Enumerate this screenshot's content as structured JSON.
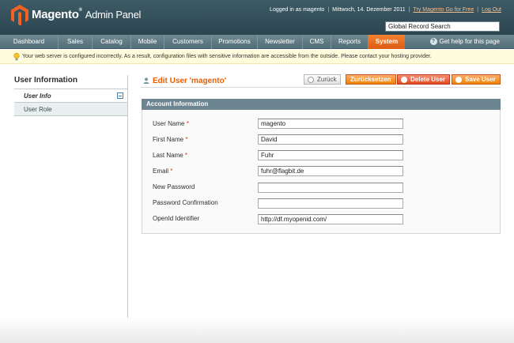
{
  "header": {
    "brand": "Magento",
    "brand_tm": "®",
    "brand_sub": "Admin Panel",
    "logged_in": "Logged in as magento",
    "date": "Mittwoch, 14. Dezember 2011",
    "try_go_link": "Try Magento Go for Free",
    "logout_link": "Log Out",
    "search_value": "Global Record Search"
  },
  "nav": {
    "items": [
      "Dashboard",
      "Sales",
      "Catalog",
      "Mobile",
      "Customers",
      "Promotions",
      "Newsletter",
      "CMS",
      "Reports",
      "System"
    ],
    "active": "System",
    "help": "Get help for this page"
  },
  "message": "Your web server is configured incorrectly. As a result, configuration files with sensitive information are accessible from the outside. Please contact your hosting provider.",
  "sidebar": {
    "title": "User Information",
    "tabs": [
      "User Info",
      "User Role"
    ]
  },
  "content": {
    "title": "Edit User 'magento'",
    "buttons": {
      "back": "Zurück",
      "reset": "Zurücksetzen",
      "delete": "Delete User",
      "save": "Save User"
    },
    "fieldset_title": "Account Information",
    "fields": [
      {
        "label": "User Name",
        "required": "*",
        "value": "magento"
      },
      {
        "label": "First Name",
        "required": "*",
        "value": "David"
      },
      {
        "label": "Last Name",
        "required": "*",
        "value": "Fuhr"
      },
      {
        "label": "Email",
        "required": "*",
        "value": "fuhr@flagbit.de"
      },
      {
        "label": "New Password",
        "required": "",
        "value": ""
      },
      {
        "label": "Password Confirmation",
        "required": "",
        "value": ""
      },
      {
        "label": "OpenId Identifier",
        "required": "",
        "value": "http://df.myopenid.com/"
      }
    ]
  },
  "colors": {
    "accent": "#eb5e00",
    "header_bg": "#34505b",
    "nav_active": "#e86a1e"
  }
}
